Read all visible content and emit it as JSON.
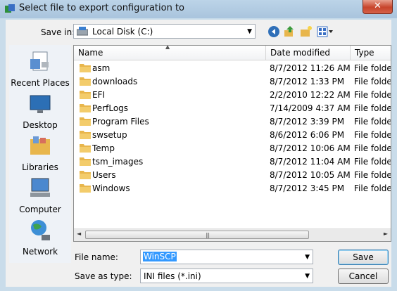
{
  "window": {
    "title": "Select file to export configuration to",
    "close_symbol": "✕"
  },
  "toolbar": {
    "save_in_label": "Save in:",
    "save_in_value": "Local Disk (C:)",
    "dropdown_symbol": "▼"
  },
  "places": [
    {
      "label": "Recent Places",
      "icon": "recent-places-icon"
    },
    {
      "label": "Desktop",
      "icon": "desktop-icon"
    },
    {
      "label": "Libraries",
      "icon": "libraries-icon"
    },
    {
      "label": "Computer",
      "icon": "computer-icon"
    },
    {
      "label": "Network",
      "icon": "network-icon"
    }
  ],
  "columns": {
    "name": "Name",
    "date": "Date modified",
    "type": "Type"
  },
  "files": [
    {
      "name": "asm",
      "date": "8/7/2012 11:26 AM",
      "type": "File folder"
    },
    {
      "name": "downloads",
      "date": "8/7/2012 1:33 PM",
      "type": "File folder"
    },
    {
      "name": "EFI",
      "date": "2/2/2010 12:22 AM",
      "type": "File folder"
    },
    {
      "name": "PerfLogs",
      "date": "7/14/2009 4:37 AM",
      "type": "File folder"
    },
    {
      "name": "Program Files",
      "date": "8/7/2012 3:39 PM",
      "type": "File folder"
    },
    {
      "name": "swsetup",
      "date": "8/6/2012 6:06 PM",
      "type": "File folder"
    },
    {
      "name": "Temp",
      "date": "8/7/2012 10:06 AM",
      "type": "File folder"
    },
    {
      "name": "tsm_images",
      "date": "8/7/2012 11:04 AM",
      "type": "File folder"
    },
    {
      "name": "Users",
      "date": "8/7/2012 10:05 AM",
      "type": "File folder"
    },
    {
      "name": "Windows",
      "date": "8/7/2012 3:45 PM",
      "type": "File folder"
    }
  ],
  "scrollbar": {
    "left": "◄",
    "right": "►",
    "grip": "|||"
  },
  "footer": {
    "file_name_label": "File name:",
    "file_name_value": "WinSCP",
    "save_as_type_label": "Save as type:",
    "save_as_type_value": "INI files (*.ini)",
    "save_button": "Save",
    "cancel_button": "Cancel"
  },
  "colors": {
    "folder": "#e8b64c",
    "selection": "#3399ff",
    "close": "#c7442b"
  }
}
